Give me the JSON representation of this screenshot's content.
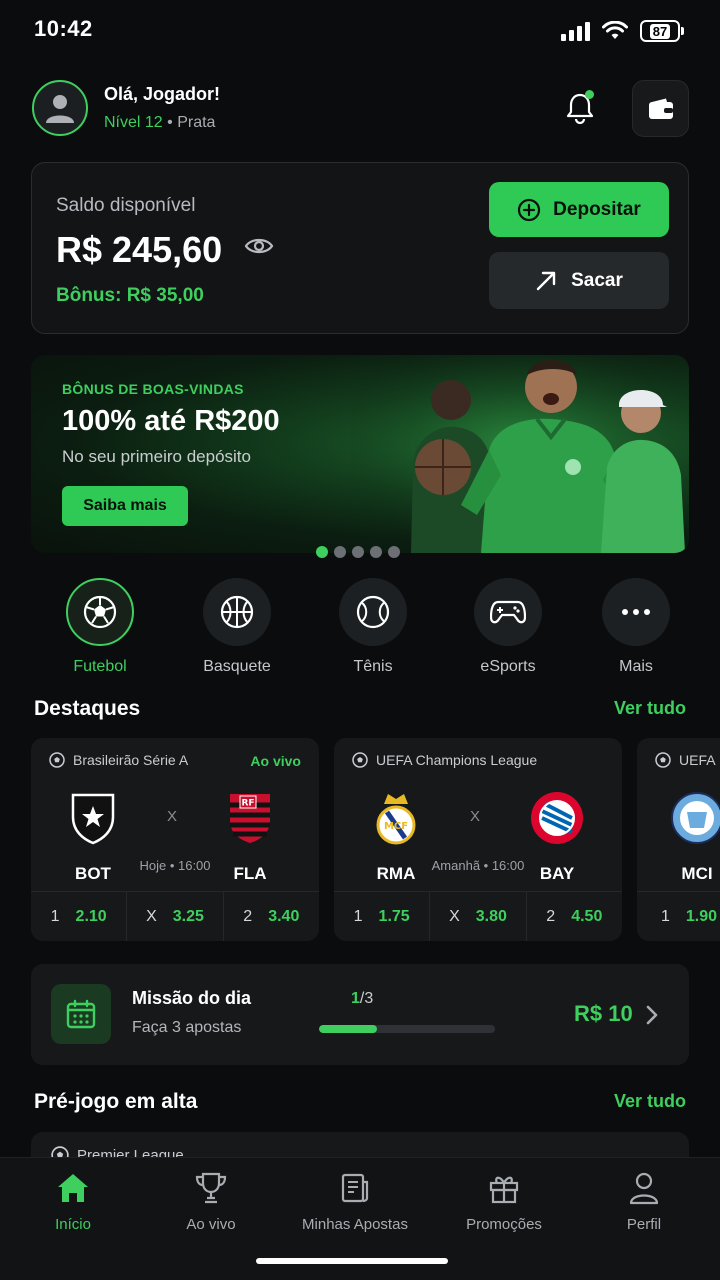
{
  "status": {
    "time": "10:42",
    "battery": "87"
  },
  "header": {
    "greeting": "Olá, Jogador!",
    "level": "Nível 12",
    "tier": "• Prata"
  },
  "balance": {
    "label": "Saldo disponível",
    "value": "R$ 245,60",
    "bonus": "Bônus: R$ 35,00",
    "deposit_label": "Depositar",
    "withdraw_label": "Sacar"
  },
  "banner": {
    "tag": "BÔNUS DE BOAS-VINDAS",
    "title": "100% até R$200",
    "subtitle": "No seu primeiro depósito",
    "button": "Saiba mais",
    "slides": 5,
    "active_slide": 1
  },
  "sports": [
    {
      "label": "Futebol",
      "icon": "soccer-ball-icon",
      "active": true
    },
    {
      "label": "Basquete",
      "icon": "basketball-icon",
      "active": false
    },
    {
      "label": "Tênis",
      "icon": "tennis-ball-icon",
      "active": false
    },
    {
      "label": "eSports",
      "icon": "gamepad-icon",
      "active": false
    },
    {
      "label": "Mais",
      "icon": "more-dots-icon",
      "active": false
    }
  ],
  "highlights": {
    "title": "Destaques",
    "see_all": "Ver tudo",
    "matches": [
      {
        "league": "Brasileirão Série A",
        "live": "Ao vivo",
        "home": "BOT",
        "away": "FLA",
        "x": "X",
        "time": "Hoje • 16:00",
        "odds": [
          {
            "k": "1",
            "v": "2.10"
          },
          {
            "k": "X",
            "v": "3.25"
          },
          {
            "k": "2",
            "v": "3.40"
          }
        ]
      },
      {
        "league": "UEFA Champions League",
        "live": "",
        "home": "RMA",
        "away": "BAY",
        "x": "X",
        "time": "Amanhã • 16:00",
        "odds": [
          {
            "k": "1",
            "v": "1.75"
          },
          {
            "k": "X",
            "v": "3.80"
          },
          {
            "k": "2",
            "v": "4.50"
          }
        ]
      },
      {
        "league": "UEFA",
        "live": "",
        "home": "MCI",
        "away": "",
        "x": "",
        "time": "",
        "odds": [
          {
            "k": "1",
            "v": "1.90"
          }
        ]
      }
    ]
  },
  "mission": {
    "title": "Missão do dia",
    "subtitle": "Faça 3 apostas",
    "progress_done": "1",
    "progress_total": "/3",
    "progress": 0.33,
    "reward": "R$ 10"
  },
  "pregame": {
    "title": "Pré-jogo em alta",
    "see_all": "Ver tudo",
    "peek_league": "Premier League"
  },
  "nav": [
    {
      "label": "Início",
      "icon": "home-icon",
      "active": true
    },
    {
      "label": "Ao vivo",
      "icon": "trophy-icon",
      "active": false
    },
    {
      "label": "Minhas Apostas",
      "icon": "bet-slip-icon",
      "active": false
    },
    {
      "label": "Promoções",
      "icon": "gift-icon",
      "active": false
    },
    {
      "label": "Perfil",
      "icon": "profile-icon",
      "active": false
    }
  ],
  "colors": {
    "accent": "#3ecf5e",
    "background": "#0b0c0d",
    "card": "#16181a"
  }
}
